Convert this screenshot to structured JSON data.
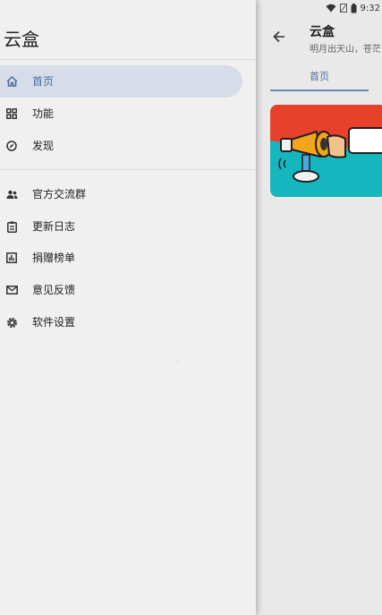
{
  "status_bar": {
    "time": "9:32",
    "icons": [
      "wifi-icon",
      "sim-icon",
      "battery-icon"
    ]
  },
  "drawer": {
    "title": "云盒",
    "primary_items": [
      {
        "label": "首页",
        "icon": "home-icon",
        "active": true
      },
      {
        "label": "功能",
        "icon": "grid-icon",
        "active": false
      },
      {
        "label": "发现",
        "icon": "compass-icon",
        "active": false
      }
    ],
    "secondary_items": [
      {
        "label": "官方交流群",
        "icon": "group-icon"
      },
      {
        "label": "更新日志",
        "icon": "clipboard-icon"
      },
      {
        "label": "捐赠榜单",
        "icon": "chart-icon"
      },
      {
        "label": "意见反馈",
        "icon": "mail-icon"
      },
      {
        "label": "软件设置",
        "icon": "settings-icon"
      }
    ]
  },
  "app": {
    "title": "云盒",
    "subtitle": "明月出天山，苍茫",
    "tabs": [
      "首页"
    ]
  },
  "colors": {
    "accent": "#4a6b9d",
    "active_bg": "#d6dde9",
    "banner_red": "#e8412b",
    "banner_teal": "#16b6be"
  }
}
